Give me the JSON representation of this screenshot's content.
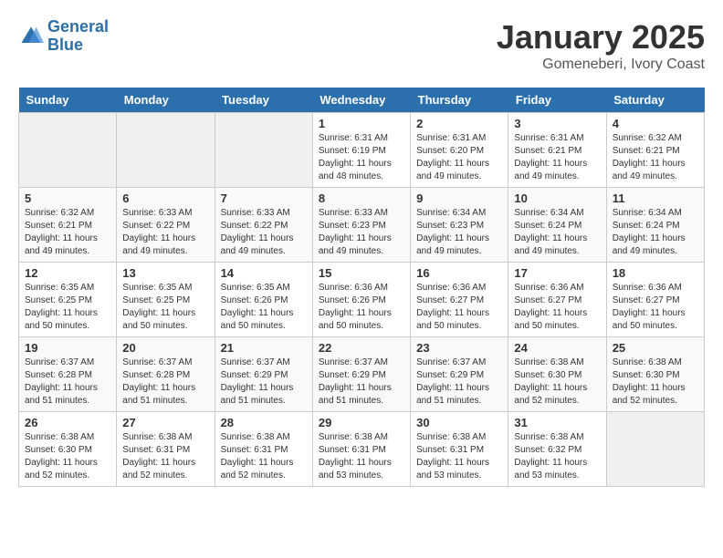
{
  "header": {
    "logo_line1": "General",
    "logo_line2": "Blue",
    "month_title": "January 2025",
    "location": "Gomeneberi, Ivory Coast"
  },
  "weekdays": [
    "Sunday",
    "Monday",
    "Tuesday",
    "Wednesday",
    "Thursday",
    "Friday",
    "Saturday"
  ],
  "weeks": [
    [
      {
        "day": "",
        "info": ""
      },
      {
        "day": "",
        "info": ""
      },
      {
        "day": "",
        "info": ""
      },
      {
        "day": "1",
        "info": "Sunrise: 6:31 AM\nSunset: 6:19 PM\nDaylight: 11 hours\nand 48 minutes."
      },
      {
        "day": "2",
        "info": "Sunrise: 6:31 AM\nSunset: 6:20 PM\nDaylight: 11 hours\nand 49 minutes."
      },
      {
        "day": "3",
        "info": "Sunrise: 6:31 AM\nSunset: 6:21 PM\nDaylight: 11 hours\nand 49 minutes."
      },
      {
        "day": "4",
        "info": "Sunrise: 6:32 AM\nSunset: 6:21 PM\nDaylight: 11 hours\nand 49 minutes."
      }
    ],
    [
      {
        "day": "5",
        "info": "Sunrise: 6:32 AM\nSunset: 6:21 PM\nDaylight: 11 hours\nand 49 minutes."
      },
      {
        "day": "6",
        "info": "Sunrise: 6:33 AM\nSunset: 6:22 PM\nDaylight: 11 hours\nand 49 minutes."
      },
      {
        "day": "7",
        "info": "Sunrise: 6:33 AM\nSunset: 6:22 PM\nDaylight: 11 hours\nand 49 minutes."
      },
      {
        "day": "8",
        "info": "Sunrise: 6:33 AM\nSunset: 6:23 PM\nDaylight: 11 hours\nand 49 minutes."
      },
      {
        "day": "9",
        "info": "Sunrise: 6:34 AM\nSunset: 6:23 PM\nDaylight: 11 hours\nand 49 minutes."
      },
      {
        "day": "10",
        "info": "Sunrise: 6:34 AM\nSunset: 6:24 PM\nDaylight: 11 hours\nand 49 minutes."
      },
      {
        "day": "11",
        "info": "Sunrise: 6:34 AM\nSunset: 6:24 PM\nDaylight: 11 hours\nand 49 minutes."
      }
    ],
    [
      {
        "day": "12",
        "info": "Sunrise: 6:35 AM\nSunset: 6:25 PM\nDaylight: 11 hours\nand 50 minutes."
      },
      {
        "day": "13",
        "info": "Sunrise: 6:35 AM\nSunset: 6:25 PM\nDaylight: 11 hours\nand 50 minutes."
      },
      {
        "day": "14",
        "info": "Sunrise: 6:35 AM\nSunset: 6:26 PM\nDaylight: 11 hours\nand 50 minutes."
      },
      {
        "day": "15",
        "info": "Sunrise: 6:36 AM\nSunset: 6:26 PM\nDaylight: 11 hours\nand 50 minutes."
      },
      {
        "day": "16",
        "info": "Sunrise: 6:36 AM\nSunset: 6:27 PM\nDaylight: 11 hours\nand 50 minutes."
      },
      {
        "day": "17",
        "info": "Sunrise: 6:36 AM\nSunset: 6:27 PM\nDaylight: 11 hours\nand 50 minutes."
      },
      {
        "day": "18",
        "info": "Sunrise: 6:36 AM\nSunset: 6:27 PM\nDaylight: 11 hours\nand 50 minutes."
      }
    ],
    [
      {
        "day": "19",
        "info": "Sunrise: 6:37 AM\nSunset: 6:28 PM\nDaylight: 11 hours\nand 51 minutes."
      },
      {
        "day": "20",
        "info": "Sunrise: 6:37 AM\nSunset: 6:28 PM\nDaylight: 11 hours\nand 51 minutes."
      },
      {
        "day": "21",
        "info": "Sunrise: 6:37 AM\nSunset: 6:29 PM\nDaylight: 11 hours\nand 51 minutes."
      },
      {
        "day": "22",
        "info": "Sunrise: 6:37 AM\nSunset: 6:29 PM\nDaylight: 11 hours\nand 51 minutes."
      },
      {
        "day": "23",
        "info": "Sunrise: 6:37 AM\nSunset: 6:29 PM\nDaylight: 11 hours\nand 51 minutes."
      },
      {
        "day": "24",
        "info": "Sunrise: 6:38 AM\nSunset: 6:30 PM\nDaylight: 11 hours\nand 52 minutes."
      },
      {
        "day": "25",
        "info": "Sunrise: 6:38 AM\nSunset: 6:30 PM\nDaylight: 11 hours\nand 52 minutes."
      }
    ],
    [
      {
        "day": "26",
        "info": "Sunrise: 6:38 AM\nSunset: 6:30 PM\nDaylight: 11 hours\nand 52 minutes."
      },
      {
        "day": "27",
        "info": "Sunrise: 6:38 AM\nSunset: 6:31 PM\nDaylight: 11 hours\nand 52 minutes."
      },
      {
        "day": "28",
        "info": "Sunrise: 6:38 AM\nSunset: 6:31 PM\nDaylight: 11 hours\nand 52 minutes."
      },
      {
        "day": "29",
        "info": "Sunrise: 6:38 AM\nSunset: 6:31 PM\nDaylight: 11 hours\nand 53 minutes."
      },
      {
        "day": "30",
        "info": "Sunrise: 6:38 AM\nSunset: 6:31 PM\nDaylight: 11 hours\nand 53 minutes."
      },
      {
        "day": "31",
        "info": "Sunrise: 6:38 AM\nSunset: 6:32 PM\nDaylight: 11 hours\nand 53 minutes."
      },
      {
        "day": "",
        "info": ""
      }
    ]
  ]
}
